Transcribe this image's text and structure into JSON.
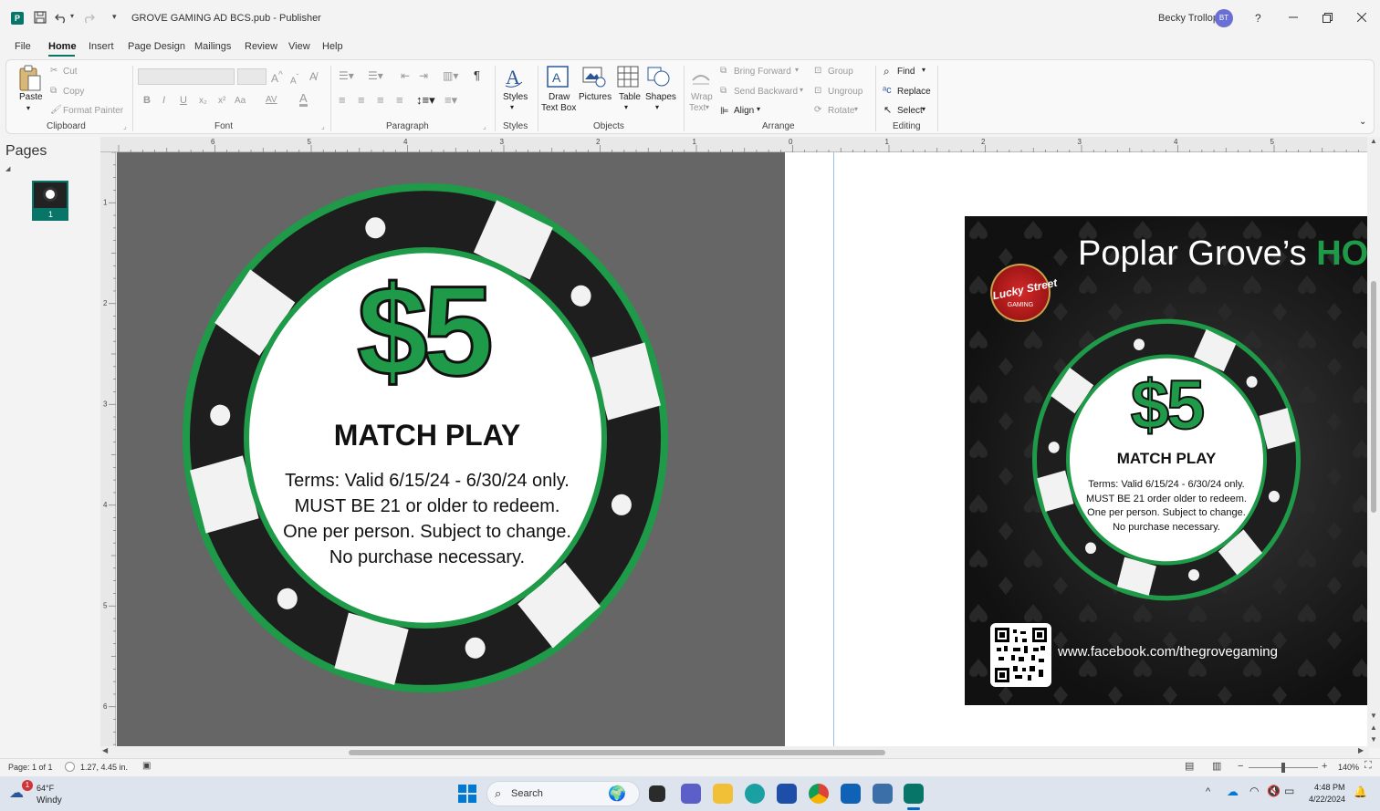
{
  "titlebar": {
    "title": "GROVE GAMING AD BCS.pub  -  Publisher",
    "user_name": "Becky Trollop",
    "user_initials": "BT",
    "help": "?"
  },
  "menu": [
    "File",
    "Home",
    "Insert",
    "Page Design",
    "Mailings",
    "Review",
    "View",
    "Help"
  ],
  "ribbon": {
    "clipboard": {
      "paste": "Paste",
      "cut": "Cut",
      "copy": "Copy",
      "format_painter": "Format Painter",
      "label": "Clipboard"
    },
    "font": {
      "label": "Font",
      "bold": "B",
      "italic": "I",
      "underline": "U",
      "subscript": "x₂",
      "superscript": "x²",
      "change_case": "Aa",
      "char_spacing": "AV",
      "font_color": "A"
    },
    "paragraph": {
      "label": "Paragraph",
      "pilcrow": "¶"
    },
    "styles": {
      "button": "Styles",
      "label": "Styles"
    },
    "objects": {
      "label": "Objects",
      "draw_text_box_1": "Draw",
      "draw_text_box_2": "Text Box",
      "pictures": "Pictures",
      "table": "Table",
      "shapes": "Shapes"
    },
    "arrange": {
      "label": "Arrange",
      "wrap_text_1": "Wrap",
      "wrap_text_2": "Text",
      "bring_forward": "Bring Forward",
      "send_backward": "Send Backward",
      "align": "Align",
      "group": "Group",
      "ungroup": "Ungroup",
      "rotate": "Rotate"
    },
    "editing": {
      "label": "Editing",
      "find": "Find",
      "replace": "Replace",
      "select": "Select"
    }
  },
  "pages_pane": {
    "title": "Pages",
    "page_number": "1"
  },
  "ruler": {
    "h_labels": [
      "6",
      "5",
      "4",
      "3",
      "2",
      "1",
      "0",
      "1",
      "2",
      "3",
      "4",
      "5"
    ],
    "v_labels": [
      "1",
      "2",
      "3",
      "4",
      "5",
      "6"
    ]
  },
  "chip": {
    "amount": "$5",
    "headline": "MATCH PLAY",
    "terms": [
      "Terms: Valid 6/15/24 - 6/30/24 only.",
      "MUST BE 21 or older to redeem.",
      "One per person.  Subject to change.",
      "No purchase necessary."
    ]
  },
  "ad": {
    "headline_white": "Poplar Grove’s ",
    "headline_green": "HO",
    "logo_text": "Lucky Street",
    "logo_sub": "GAMING",
    "chip_amount": "$5",
    "chip_headline": "MATCH PLAY",
    "chip_terms": [
      "Terms: Valid 6/15/24 - 6/30/24 only.",
      "MUST BE 21 order older to redeem.",
      "One per person.  Subject to change.",
      "No purchase necessary."
    ],
    "url": "www.facebook.com/thegrovegaming"
  },
  "statusbar": {
    "page": "Page: 1 of 1",
    "position": "1.27, 4.45 in.",
    "zoom": "140%",
    "minus": "−",
    "plus": "+"
  },
  "taskbar": {
    "weather_temp": "64°F",
    "weather_desc": "Windy",
    "notification_count": "1",
    "search": "Search",
    "time": "4:48 PM",
    "date": "4/22/2024"
  },
  "colors": {
    "green": "#1e9a48",
    "chip_black": "#1e1e1e",
    "accent_blue": "#2b579a",
    "publisher_teal": "#077568"
  }
}
